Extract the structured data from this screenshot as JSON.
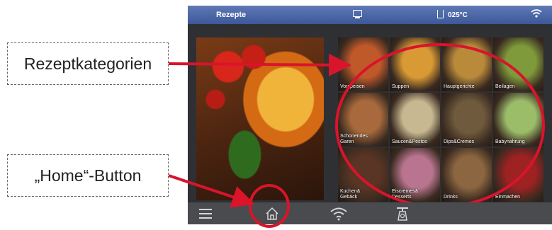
{
  "callouts": {
    "categories": "Rezeptkategorien",
    "home": "„Home“-Button"
  },
  "statusbar": {
    "title": "Rezepte",
    "temperature": "025°C",
    "icons": [
      "monitor-icon",
      "thermometer-icon",
      "wifi-icon"
    ]
  },
  "carousel": {
    "page_count": 6,
    "active_index": 0
  },
  "categories": [
    {
      "label": "Vorspeisen",
      "color": "#c0592a"
    },
    {
      "label": "Suppen",
      "color": "#d99a35"
    },
    {
      "label": "Hauptgerichte",
      "color": "#b98a3a"
    },
    {
      "label": "Beilagen",
      "color": "#7f9a3b"
    },
    {
      "label": "Schonendes\nGaren",
      "color": "#a86a3c"
    },
    {
      "label": "Saucen&Pestos",
      "color": "#c7b891"
    },
    {
      "label": "Dips&Cremes",
      "color": "#6f5a3d"
    },
    {
      "label": "Babynahrung",
      "color": "#9bbd6a"
    },
    {
      "label": "Kuchen&\nGebäck",
      "color": "#5a3424"
    },
    {
      "label": "Eiscremes&\nDesserts",
      "color": "#b9758f"
    },
    {
      "label": "Drinks",
      "color": "#8b6640"
    },
    {
      "label": "Einmachen",
      "color": "#9e2222"
    }
  ],
  "navbar": {
    "items": [
      "menu-icon",
      "home-icon",
      "wifi-icon",
      "scale-icon"
    ]
  },
  "colors": {
    "accent": "#d9142b",
    "statusbar": "#4a66a8",
    "navbar": "#4a4b4e"
  }
}
